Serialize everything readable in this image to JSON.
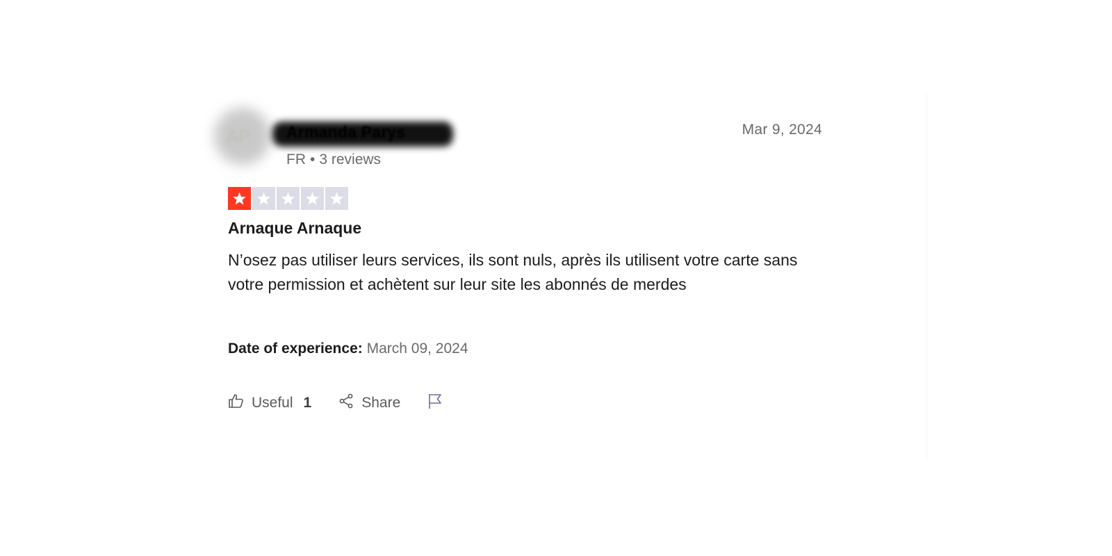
{
  "review": {
    "author": {
      "initials": "AP",
      "name": "Armanda Parys",
      "country": "FR",
      "separator": "•",
      "reviews": "3 reviews"
    },
    "date": "Mar 9, 2024",
    "rating": 1,
    "rating_max": 5,
    "title": "Arnaque Arnaque",
    "body": "N’osez pas utiliser leurs services, ils sont nuls, après ils utilisent votre carte sans votre permission et achètent sur leur site les abonnés de merdes",
    "experience": {
      "label": "Date of experience:",
      "value": "March 09, 2024"
    }
  },
  "actions": {
    "useful_label": "Useful",
    "useful_count": "1",
    "share_label": "Share"
  },
  "icons": {
    "useful": "thumbs-up-icon",
    "share": "share-icon",
    "report": "flag-icon",
    "star": "star-icon"
  },
  "colors": {
    "star_filled": "#ff3722",
    "star_empty": "#dcdce6",
    "text_primary": "#1c1c1c",
    "text_secondary": "#696a6a"
  }
}
